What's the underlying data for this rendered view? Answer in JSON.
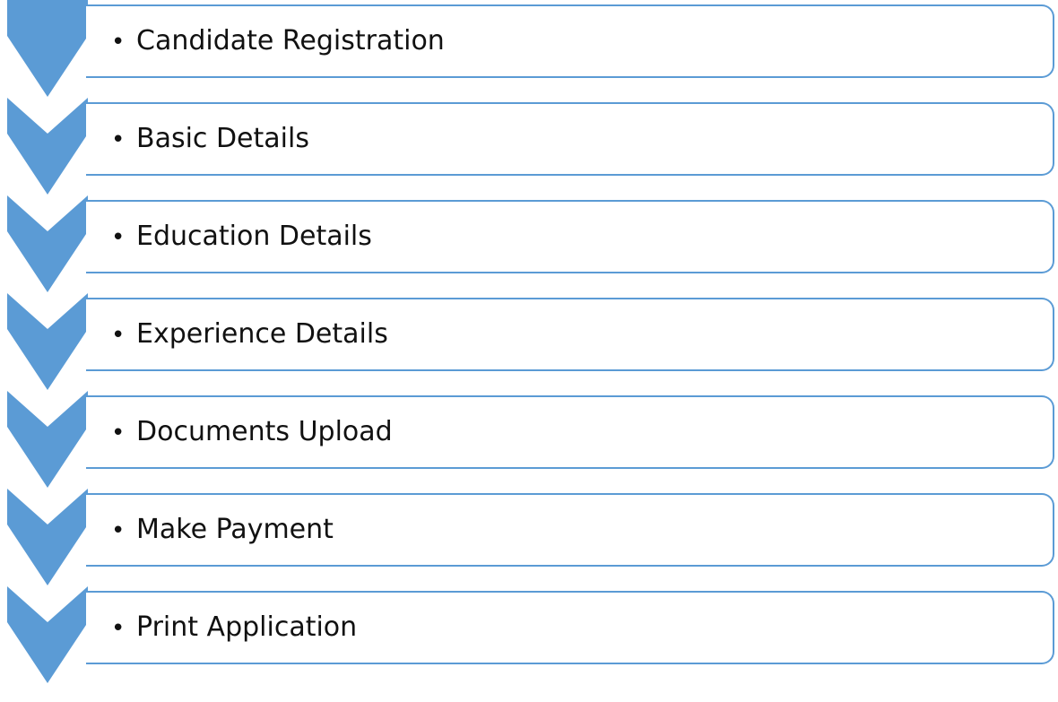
{
  "colors": {
    "chevron": "#5B9BD5",
    "box_border": "#5B9BD5",
    "text": "#111111"
  },
  "bullet": "•",
  "steps": [
    {
      "label": "Candidate Registration"
    },
    {
      "label": "Basic Details"
    },
    {
      "label": "Education Details"
    },
    {
      "label": "Experience Details"
    },
    {
      "label": "Documents Upload"
    },
    {
      "label": "Make Payment"
    },
    {
      "label": "Print Application"
    }
  ]
}
